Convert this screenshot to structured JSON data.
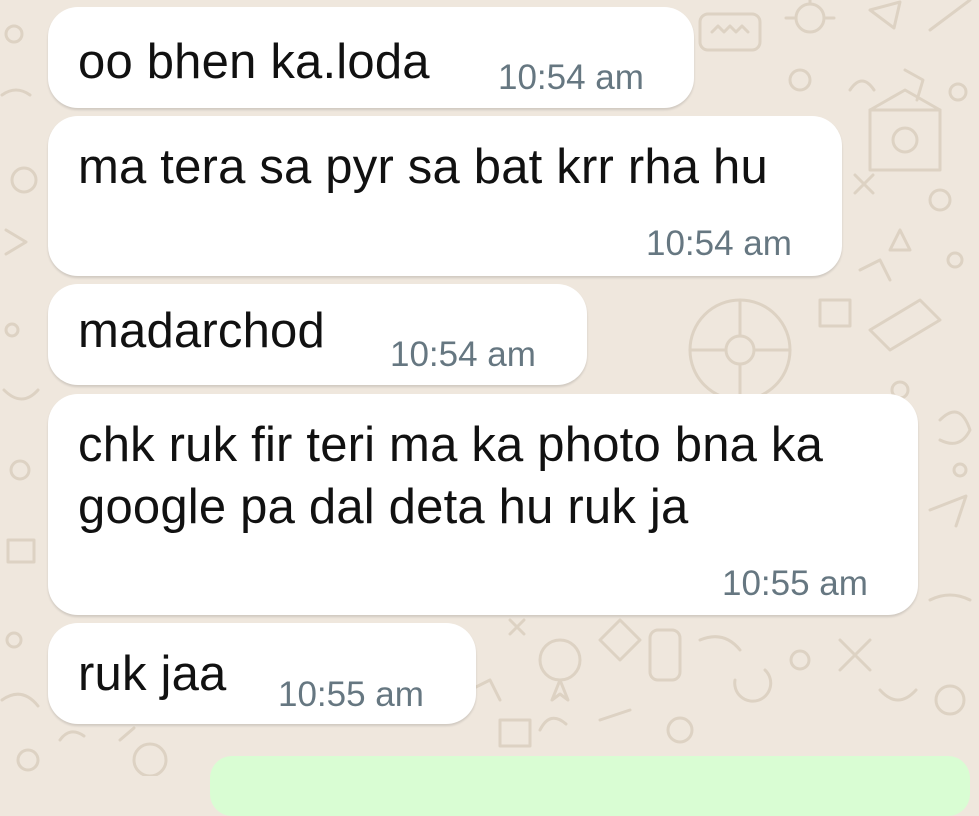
{
  "chat": {
    "messages": [
      {
        "text": "oo bhen ka.loda",
        "time": "10:54 am"
      },
      {
        "text": "ma tera sa pyr sa bat krr rha hu",
        "time": "10:54 am"
      },
      {
        "text": "madarchod",
        "time": "10:54 am"
      },
      {
        "text_line1": "chk ruk fir teri ma ka photo bna ka",
        "text_line2": "google pa dal deta hu ruk ja",
        "time": "10:55 am"
      },
      {
        "text": "ruk jaa",
        "time": "10:55 am"
      }
    ]
  },
  "colors": {
    "wallpaper": "#efe7dd",
    "incoming_bubble": "#ffffff",
    "outgoing_bubble": "#d9fdd3",
    "timestamp": "#667781",
    "doodle": "#ded3c4"
  },
  "icons": [
    "doodle-wallpaper-pattern"
  ]
}
